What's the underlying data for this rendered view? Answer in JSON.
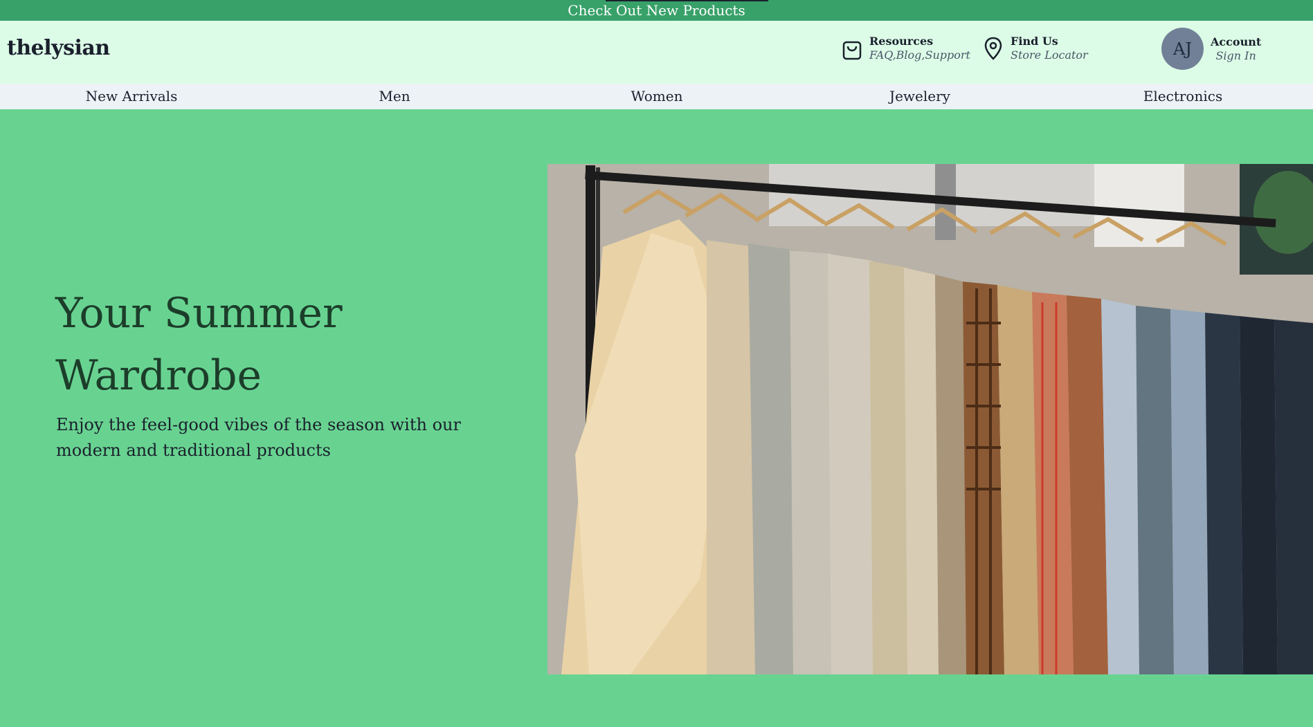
{
  "announcement": {
    "text": "Check Out New Products"
  },
  "header": {
    "logo": "thelysian",
    "resources": {
      "title": "Resources",
      "subtitle": "FAQ,Blog,Support",
      "icon": "shopping-bag-icon"
    },
    "find_us": {
      "title": "Find Us",
      "subtitle": "Store Locator",
      "icon": "map-pin-icon"
    },
    "account": {
      "initials": "AJ",
      "title": "Account",
      "subtitle": "Sign In"
    }
  },
  "nav": {
    "items": [
      {
        "label": "New Arrivals"
      },
      {
        "label": "Men"
      },
      {
        "label": "Women"
      },
      {
        "label": "Jewelery"
      },
      {
        "label": "Electronics"
      }
    ]
  },
  "hero": {
    "title": "Your Summer Wardrobe",
    "subtitle": "Enjoy the feel-good vibes of the season with our modern and traditional products",
    "image_subject": "clothing rack photo"
  },
  "colors": {
    "announcement_bg": "#38a169",
    "header_bg": "#dcfce7",
    "nav_bg": "#edf2f7",
    "hero_bg": "#68d391",
    "avatar_bg": "#718096"
  }
}
